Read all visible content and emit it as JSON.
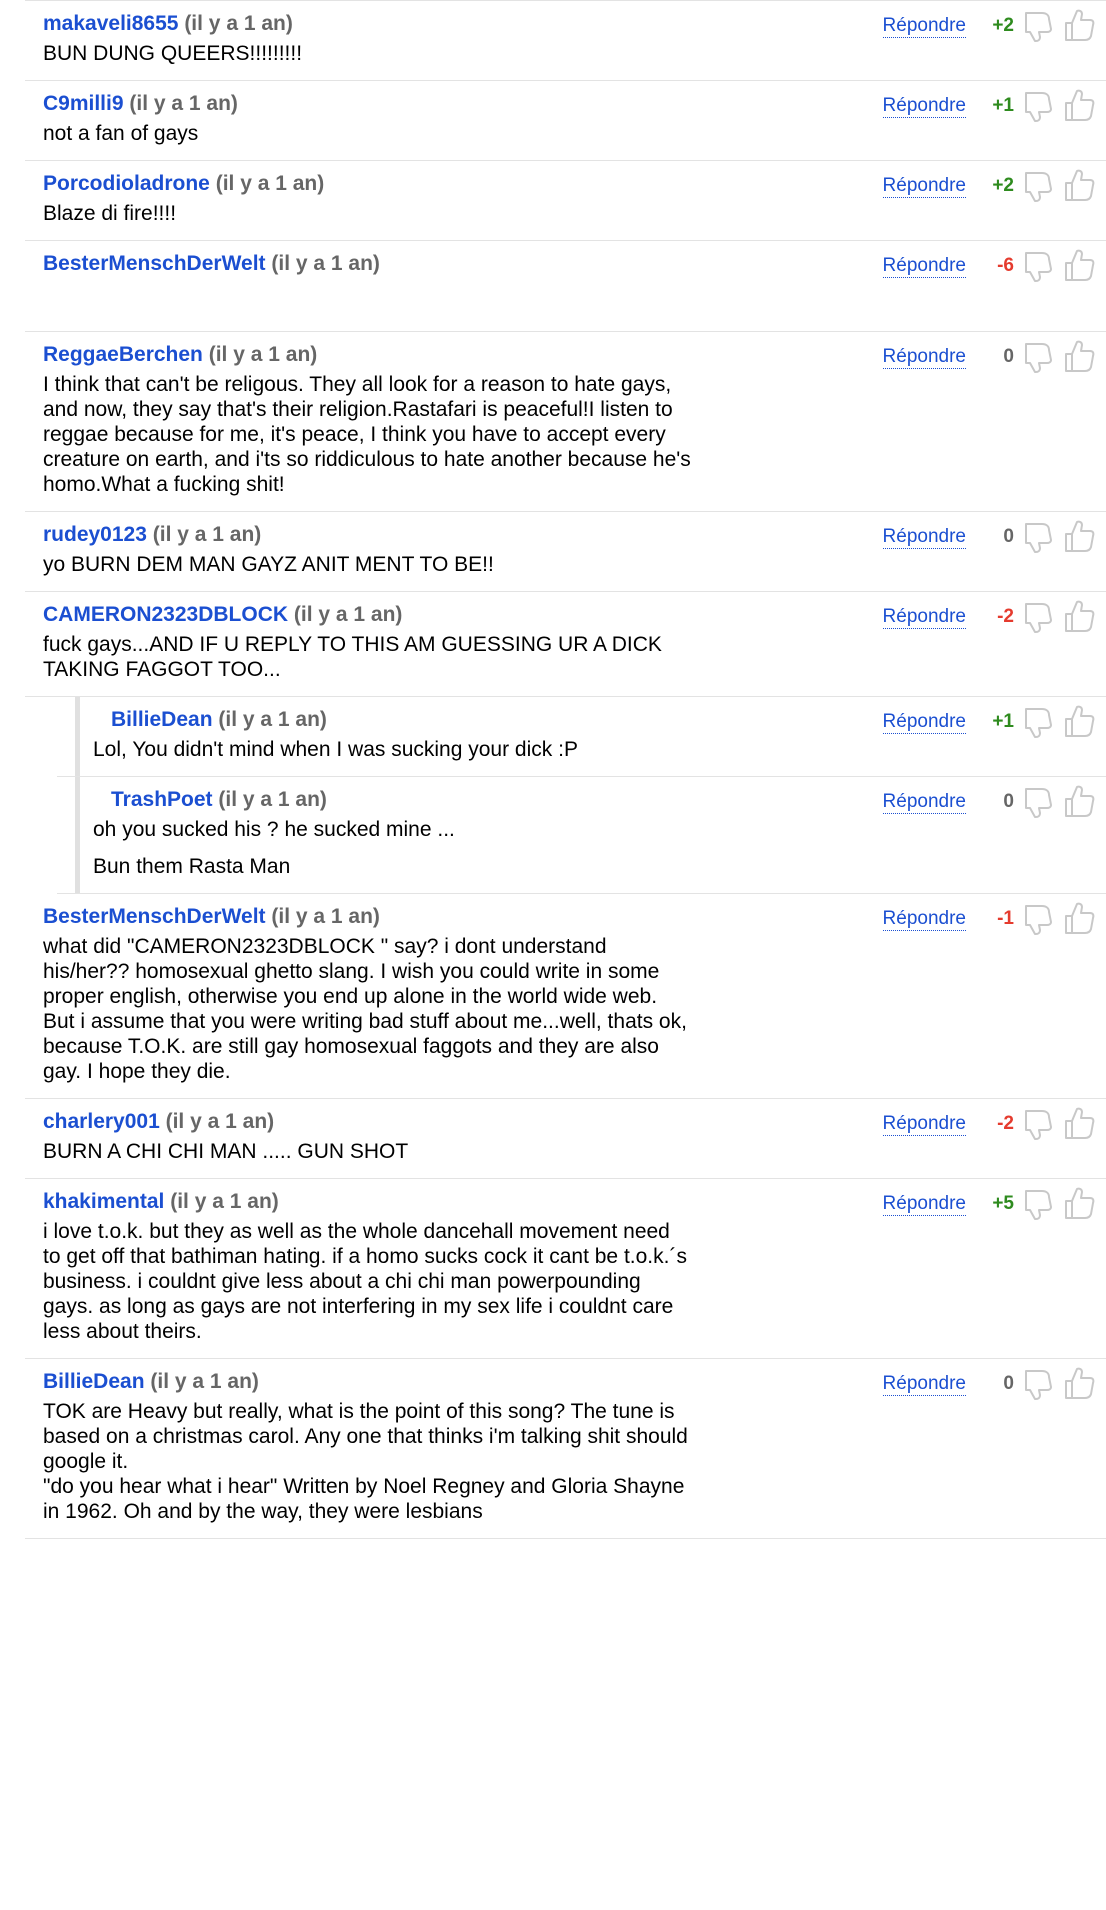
{
  "reply_label": "Répondre",
  "comments": [
    {
      "author": "makaveli8655",
      "ago": "(il y a 1 an)",
      "score": "+2",
      "score_class": "pos",
      "text": [
        "BUN DUNG QUEERS!!!!!!!!!"
      ]
    },
    {
      "author": "C9milli9",
      "ago": "(il y a 1 an)",
      "score": "+1",
      "score_class": "pos",
      "text": [
        "not a fan of gays"
      ]
    },
    {
      "author": "Porcodioladrone",
      "ago": "(il y a 1 an)",
      "score": "+2",
      "score_class": "pos",
      "text": [
        "Blaze di fire!!!!"
      ]
    },
    {
      "author": "BesterMenschDerWelt",
      "ago": "(il y a 1 an)",
      "score": "-6",
      "score_class": "neg",
      "text": []
    },
    {
      "author": "ReggaeBerchen",
      "ago": "(il y a 1 an)",
      "score": "0",
      "score_class": "zero",
      "text": [
        "I think that can't be religous. They all look for a reason to hate gays, and now, they say that's their religion.Rastafari is peaceful!I listen to reggae because for me, it's peace, I think you have to accept every creature on earth, and i'ts so riddiculous to hate another because he's homo.What a fucking shit!"
      ]
    },
    {
      "author": "rudey0123",
      "ago": "(il y a 1 an)",
      "score": "0",
      "score_class": "zero",
      "text": [
        "yo BURN DEM MAN GAYZ ANIT MENT TO BE!!"
      ]
    },
    {
      "author": "CAMERON2323DBLOCK",
      "ago": "(il y a 1 an)",
      "score": "-2",
      "score_class": "neg",
      "text": [
        "fuck gays...AND IF U REPLY TO THIS AM GUESSING UR A DICK TAKING FAGGOT TOO..."
      ]
    },
    {
      "author": "BillieDean",
      "ago": "(il y a 1 an)",
      "score": "+1",
      "score_class": "pos",
      "reply": true,
      "text": [
        "Lol, You didn't mind when I was sucking your dick :P"
      ]
    },
    {
      "author": "TrashPoet",
      "ago": "(il y a 1 an)",
      "score": "0",
      "score_class": "zero",
      "reply": true,
      "text": [
        "oh you sucked his ? he sucked mine ...",
        "Bun them Rasta Man"
      ]
    },
    {
      "author": "BesterMenschDerWelt",
      "ago": "(il y a 1 an)",
      "score": "-1",
      "score_class": "neg",
      "text": [
        "what did \"CAMERON2323DBLOCK \" say? i dont understand his/her?? homosexual ghetto slang. I wish you could write in some proper english, otherwise you end up alone in the world wide web. But i assume that you were writing bad stuff about me...well, thats ok, because T.O.K. are still gay homosexual faggots and they are also gay. I hope they die."
      ]
    },
    {
      "author": "charlery001",
      "ago": "(il y a 1 an)",
      "score": "-2",
      "score_class": "neg",
      "text": [
        "BURN A CHI CHI MAN ..... GUN SHOT"
      ]
    },
    {
      "author": "khakimental",
      "ago": "(il y a 1 an)",
      "score": "+5",
      "score_class": "pos",
      "text": [
        "i love t.o.k. but they as well as the whole dancehall movement need to get off that bathiman hating. if a homo sucks cock it cant be t.o.k.´s business. i couldnt give less about a chi chi man powerpounding gays. as long as gays are not interfering in my sex life i couldnt care less about theirs."
      ]
    },
    {
      "author": "BillieDean",
      "ago": "(il y a 1 an)",
      "score": "0",
      "score_class": "zero",
      "text": [
        "TOK are Heavy but really, what is the point of this song? The tune is based on a christmas carol. Any one that thinks i'm talking shit should google it.\n\"do you hear what i hear\" Written by Noel Regney and Gloria Shayne in 1962. Oh and by the way, they were lesbians"
      ]
    }
  ],
  "icons": {
    "down": "thumbs-down-icon",
    "up": "thumbs-up-icon"
  }
}
